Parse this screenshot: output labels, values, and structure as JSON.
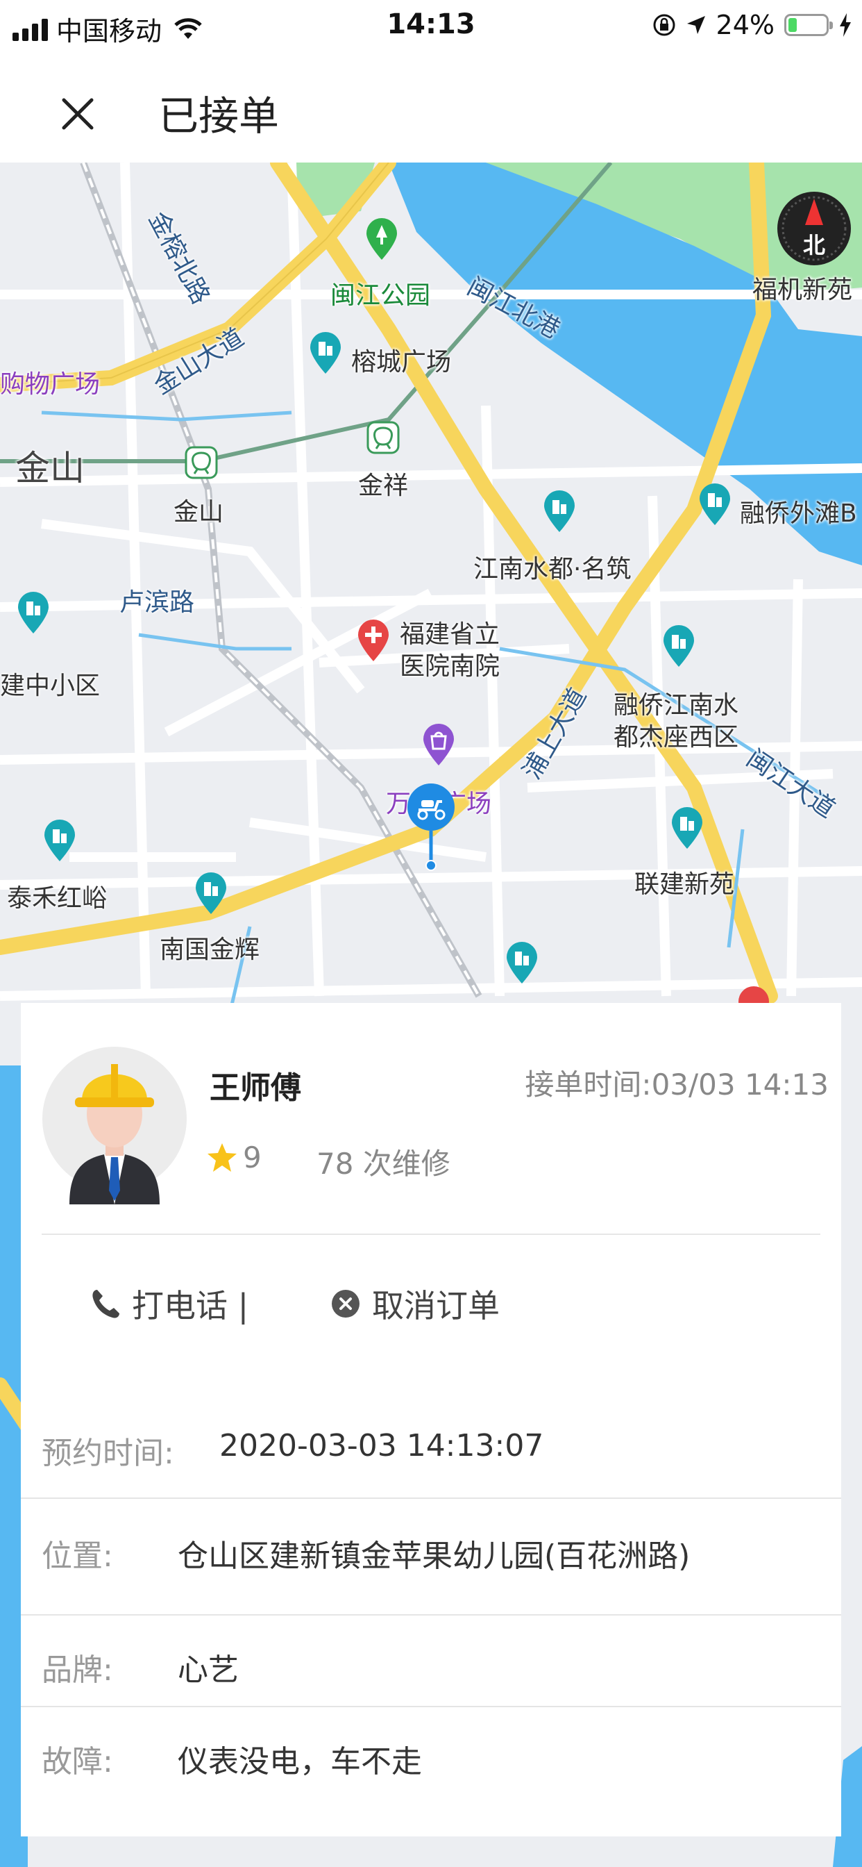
{
  "status_bar": {
    "carrier": "中国移动",
    "time": "14:13",
    "battery_percent": "24%",
    "battery_level": 0.24,
    "icons": [
      "signal-icon",
      "wifi-icon",
      "orientation-lock-icon",
      "location-arrow-icon",
      "battery-icon",
      "charging-bolt-icon"
    ]
  },
  "nav": {
    "title": "已接单",
    "close_icon": "close-icon"
  },
  "map": {
    "compass_label": "北",
    "labels": {
      "jinshan_dadao": "金山大道",
      "jinrong_beilu": "金榕北路",
      "minjiang_park": "闽江公园",
      "minjiang_beigang": "闽江北港",
      "fuji_xinyuan": "福机新苑",
      "gouwu_guangchang": "购物广场",
      "rongcheng_guangchang": "榕城广场",
      "jinshan_area": "金山",
      "jinshan_station": "金山",
      "jinxiang": "金祥",
      "rongqiao_waitan": "融侨外滩B",
      "jiangnan_shuidu": "江南水都·名筑",
      "lubin_lu": "卢滨路",
      "fujian_hospital_1": "福建省立",
      "fujian_hospital_2": "医院南院",
      "pushang_dadao": "浦上大道",
      "rongqiao_jiangnan_1": "融侨江南水",
      "rongqiao_jiangnan_2": "都杰座西区",
      "minjiang_dadao": "闽江大道",
      "jianzhong_xiaoqu": "建中小区",
      "wanda_left": "万",
      "wanda_right": "广场",
      "taihe_hongyu": "泰禾红峪",
      "nanguo_jinhui": "南国金辉",
      "lianjian_xinyuan": "联建新苑"
    }
  },
  "order": {
    "worker_name": "王师傅",
    "accept_time": "接单时间:03/03 14:13",
    "rating": "9",
    "repair_count": "78 次维修",
    "actions": {
      "call": "打电话 |",
      "cancel": "取消订单"
    },
    "details": [
      {
        "label": "预约时间:",
        "value": "2020-03-03 14:13:07"
      },
      {
        "label": "位置:",
        "value": "仓山区建新镇金苹果幼儿园(百花洲路)"
      },
      {
        "label": "品牌:",
        "value": "心艺"
      },
      {
        "label": "故障:",
        "value": "仪表没电，车不走"
      }
    ]
  },
  "colors": {
    "river": "#57b8f2",
    "major_road": "#f7d55c",
    "park": "#9fe0a6",
    "marker_blue": "#1f8be3",
    "poi_teal": "#18a7b5",
    "hospital_red": "#e64545",
    "mall_purple": "#8e53d1",
    "star": "#f8c21a"
  }
}
